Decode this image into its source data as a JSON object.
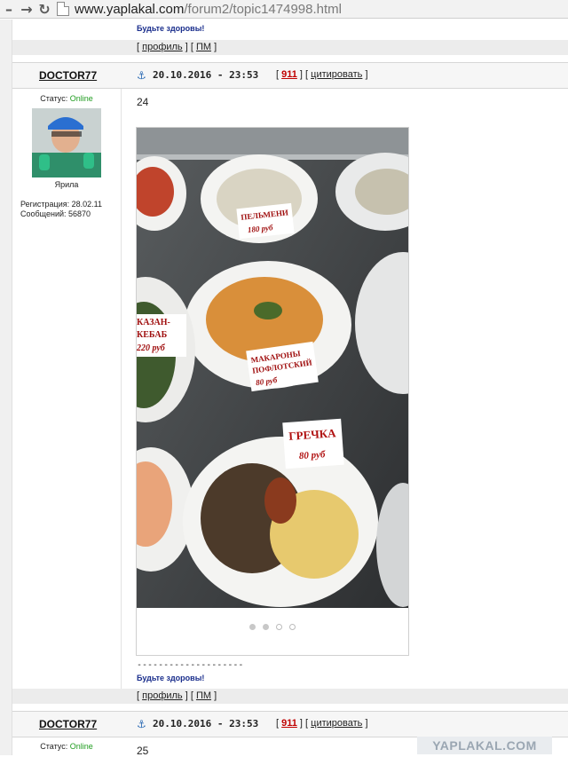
{
  "browser": {
    "url_host": "www.yaplakal.com",
    "url_path": "/forum2/topic1474998.html"
  },
  "prev_post": {
    "signature": "Будьте здоровы!",
    "links": {
      "profile": "профиль",
      "pm": "ПМ"
    }
  },
  "post": {
    "author": "DOCTOR77",
    "date": "20.10.2016 - 23:53",
    "rating": "911",
    "quote_label": "цитировать",
    "status_label": "Статус:",
    "status_value": "Online",
    "nickname": "Ярила",
    "registration": "Регистрация: 28.02.11",
    "messages": "Сообщений: 56870",
    "number": "24",
    "photo_labels": {
      "pelmeni": "ПЕЛЬМЕНИ",
      "pelmeni_price": "180 руб",
      "makarony": "МАКАРОНЫ",
      "poflotski": "ПОФЛОТСКИЙ",
      "makarony_price": "80 руб",
      "kazan_1": "КАЗАН-",
      "kazan_2": "КЕБАБ",
      "kazan_price": "220 руб",
      "grechka": "ГРЕЧКА",
      "grechka_price": "80 руб"
    },
    "gallery_dots": 4,
    "gallery_active": 2,
    "sig_separator": "--------------------",
    "signature": "Будьте здоровы!",
    "links": {
      "profile": "профиль",
      "pm": "ПМ"
    }
  },
  "next_post": {
    "author": "DOCTOR77",
    "date": "20.10.2016 - 23:53",
    "rating": "911",
    "quote_label": "цитировать",
    "status_label": "Статус:",
    "status_value": "Online",
    "number": "25"
  },
  "watermark": "YAPLAKAL.COM",
  "colors": {
    "online": "#1f9c1f",
    "rating": "#c00000",
    "signature": "#1a2e8c"
  }
}
